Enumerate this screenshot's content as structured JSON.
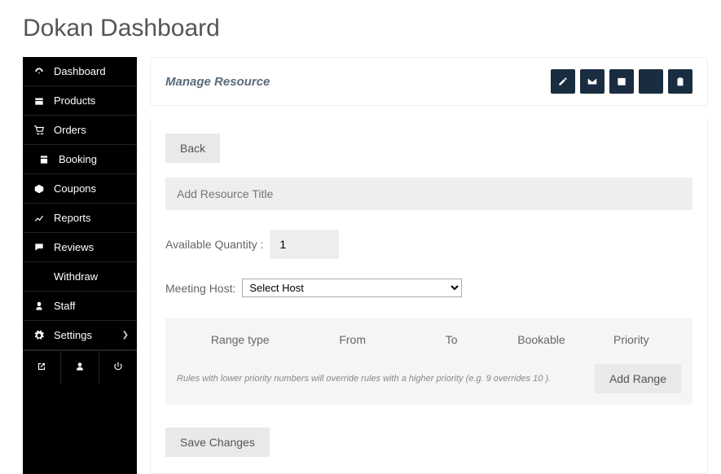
{
  "page_title": "Dokan Dashboard",
  "sidebar": {
    "items": [
      {
        "label": "Dashboard",
        "icon": "dashboard"
      },
      {
        "label": "Products",
        "icon": "products"
      },
      {
        "label": "Orders",
        "icon": "orders"
      },
      {
        "label": "Booking",
        "icon": "booking",
        "indent": true
      },
      {
        "label": "Coupons",
        "icon": "coupons"
      },
      {
        "label": "Reports",
        "icon": "reports"
      },
      {
        "label": "Reviews",
        "icon": "reviews"
      },
      {
        "label": "Withdraw",
        "icon": "withdraw"
      },
      {
        "label": "Staff",
        "icon": "staff"
      },
      {
        "label": "Settings",
        "icon": "settings",
        "chevron": true
      }
    ]
  },
  "header": {
    "title": "Manage Resource",
    "actions": [
      "edit",
      "mail",
      "calendar",
      "list",
      "clipboard"
    ]
  },
  "form": {
    "back_label": "Back",
    "title_placeholder": "Add Resource Title",
    "qty_label": "Available Quantity :",
    "qty_value": "1",
    "host_label": "Meeting Host:",
    "host_selected": "Select Host",
    "range": {
      "col_range": "Range type",
      "col_from": "From",
      "col_to": "To",
      "col_bookable": "Bookable",
      "col_priority": "Priority",
      "hint": "Rules with lower priority numbers will override rules with a higher priority (e.g. 9 overrides 10 ).",
      "add_label": "Add Range"
    },
    "save_label": "Save Changes"
  }
}
